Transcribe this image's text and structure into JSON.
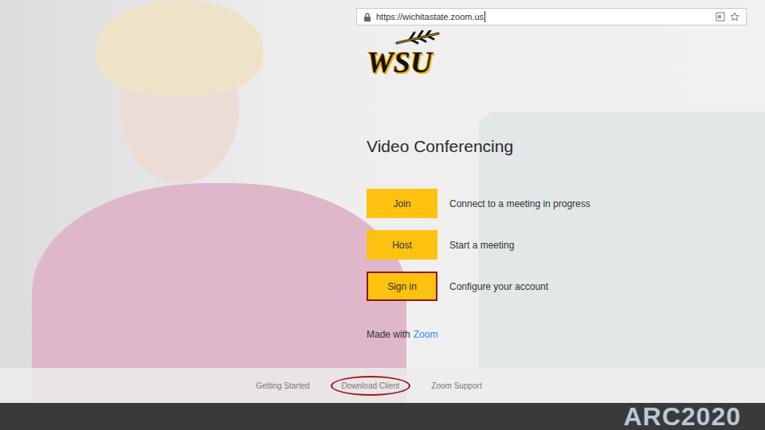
{
  "address_bar": {
    "url": "https://wichitastate.zoom.us"
  },
  "logo": {
    "text": "WSU"
  },
  "page_title": "Video Conferencing",
  "actions": [
    {
      "label": "Join",
      "description": "Connect to a meeting in progress",
      "selected": false
    },
    {
      "label": "Host",
      "description": "Start a meeting",
      "selected": false
    },
    {
      "label": "Sign in",
      "description": "Configure your account",
      "selected": true
    }
  ],
  "made_with": {
    "prefix": "Made with",
    "link": "Zoom"
  },
  "footer_links": [
    {
      "label": "Getting Started",
      "highlighted": false
    },
    {
      "label": "Download Client",
      "highlighted": true
    },
    {
      "label": "Zoom Support",
      "highlighted": false
    }
  ],
  "slide_footer": {
    "text": "ARC2020"
  }
}
